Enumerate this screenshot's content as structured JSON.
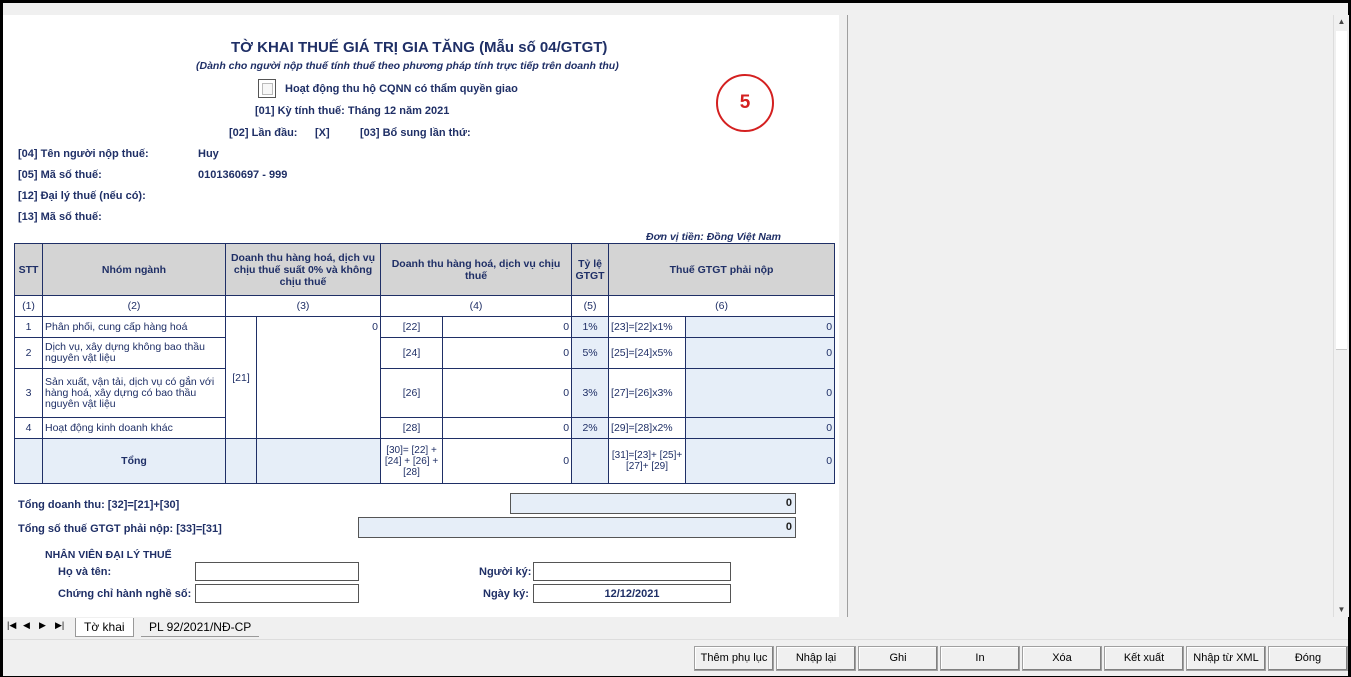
{
  "form": {
    "title": "TỜ KHAI THUẾ GIÁ TRỊ GIA TĂNG (Mẫu số 04/GTGT)",
    "subtitle": "(Dành cho người nộp thuế tính thuế theo phương pháp tính trực tiếp trên doanh thu)",
    "checkbox_label": "Hoạt động thu hộ CQNN có thẩm quyền giao",
    "ky_tinh_thue": "[01]   Kỳ tính thuế: Tháng 12 năm 2021",
    "lan_dau_label": "[02]  Lần đầu:",
    "lan_dau_value": "[X]",
    "bo_sung_label": "[03] Bổ sung lần thứ:",
    "badge": "5",
    "ten_nnt_label": "[04]  Tên người nộp thuế:",
    "ten_nnt_value": "Huy",
    "mst_label": "[05]  Mã số thuế:",
    "mst_value": "0101360697 - 999",
    "dai_ly_label": "[12]  Đại lý thuế (nếu có):",
    "mst_dl_label": "[13]  Mã số thuế:",
    "don_vi": "Đơn vị tiền: Đồng Việt Nam"
  },
  "table": {
    "headers": {
      "stt": "STT",
      "nhom": "Nhóm ngành",
      "dt0": "Doanh thu hàng hoá, dịch vụ chịu thuế suất 0% và không chịu thuế",
      "dt": "Doanh thu hàng hoá, dịch vụ chịu thuế",
      "tyle": "Tỷ lệ GTGT",
      "thue": "Thuế GTGT phải nộp"
    },
    "nums": [
      "(1)",
      "(2)",
      "(3)",
      "(4)",
      "(5)",
      "(6)"
    ],
    "code21": "[21]",
    "val21": "0",
    "rows": [
      {
        "stt": "1",
        "name": "Phân phối, cung cấp hàng hoá",
        "code": "[22]",
        "dt": "0",
        "rate": "1%",
        "formula": "[23]=[22]x1%",
        "tax": "0"
      },
      {
        "stt": "2",
        "name": "Dịch vụ, xây dựng không bao thầu nguyên vật liệu",
        "code": "[24]",
        "dt": "0",
        "rate": "5%",
        "formula": "[25]=[24]x5%",
        "tax": "0"
      },
      {
        "stt": "3",
        "name": "Sản xuất, vận tải, dịch vụ có gắn với hàng hoá, xây dựng có bao thầu nguyên vật liệu",
        "code": "[26]",
        "dt": "0",
        "rate": "3%",
        "formula": "[27]=[26]x3%",
        "tax": "0"
      },
      {
        "stt": "4",
        "name": "Hoạt động kinh doanh khác",
        "code": "[28]",
        "dt": "0",
        "rate": "2%",
        "formula": "[29]=[28]x2%",
        "tax": "0"
      }
    ],
    "total": {
      "label": "Tổng",
      "code": "[30]= [22] + [24] + [26] + [28]",
      "dt": "0",
      "formula": "[31]=[23]+ [25]+ [27]+ [29]",
      "tax": "0"
    }
  },
  "summary": {
    "tong_dt_label": "Tổng doanh thu: [32]=[21]+[30]",
    "tong_dt_value": "0",
    "tong_thue_label": "Tổng số thuế GTGT phải nộp: [33]=[31]",
    "tong_thue_value": "0"
  },
  "agent": {
    "heading": "NHÂN VIÊN ĐẠI LÝ THUẾ",
    "ho_ten_label": "Họ và tên:",
    "chung_chi_label": "Chứng chỉ hành nghề số:",
    "nguoi_ky_label": "Người ký:",
    "ngay_ky_label": "Ngày ký:",
    "ngay_ky_value": "12/12/2021"
  },
  "sheets": {
    "nav": [
      "|◀",
      "◀",
      "▶",
      "▶|"
    ],
    "active": "Tờ khai",
    "other": "PL 92/2021/NĐ-CP"
  },
  "buttons": {
    "them_phu_luc": "Thêm phụ lục",
    "nhap_lai": "Nhập lại",
    "ghi": "Ghi",
    "in": "In",
    "xoa": "Xóa",
    "ket_xuat": "Kết xuất",
    "nhap_xml": "Nhập từ XML",
    "dong": "Đóng"
  }
}
